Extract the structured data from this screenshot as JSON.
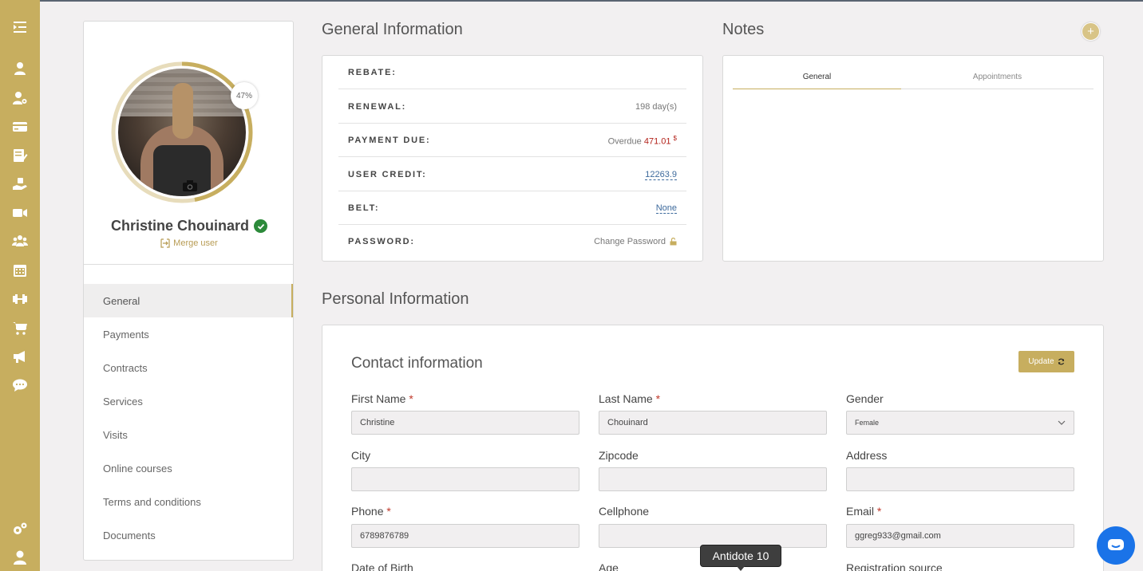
{
  "profile": {
    "name": "Christine Chouinard",
    "completion": "47%",
    "merge_label": "Merge user",
    "nav": [
      "General",
      "Payments",
      "Contracts",
      "Services",
      "Visits",
      "Online courses",
      "Terms and conditions",
      "Documents"
    ],
    "active_nav": "General",
    "completion_fraction": 0.47
  },
  "general_info": {
    "title": "General Information",
    "rows": [
      {
        "label": "REBATE:",
        "value": ""
      },
      {
        "label": "RENEWAL:",
        "value": "198 day(s)"
      },
      {
        "label": "PAYMENT DUE:",
        "prefix": "Overdue",
        "value": "471.01",
        "unit": "$"
      },
      {
        "label": "USER CREDIT:",
        "value": "12263.9"
      },
      {
        "label": "BELT:",
        "value": "None"
      },
      {
        "label": "PASSWORD:",
        "value": "Change Password"
      }
    ]
  },
  "notes": {
    "title": "Notes",
    "add_symbol": "+",
    "tabs": [
      "General",
      "Appointments"
    ],
    "active_tab": "General"
  },
  "personal_info": {
    "title": "Personal Information",
    "section_title": "Contact information",
    "update_label": "Update",
    "fields": {
      "first_name": {
        "label": "First Name",
        "required": "*",
        "value": "Christine"
      },
      "last_name": {
        "label": "Last Name",
        "required": "*",
        "value": "Chouinard"
      },
      "gender": {
        "label": "Gender",
        "value": "Female"
      },
      "city": {
        "label": "City",
        "value": ""
      },
      "zipcode": {
        "label": "Zipcode",
        "value": ""
      },
      "address": {
        "label": "Address",
        "value": ""
      },
      "phone": {
        "label": "Phone",
        "required": "*",
        "value": "6789876789"
      },
      "cellphone": {
        "label": "Cellphone",
        "value": ""
      },
      "email": {
        "label": "Email",
        "required": "*",
        "value": "ggreg933@gmail.com"
      },
      "dob": {
        "label": "Date of Birth"
      },
      "age": {
        "label": "Age"
      },
      "registration_source": {
        "label": "Registration source"
      }
    }
  },
  "tooltip": {
    "text": "Antidote 10"
  },
  "rail_icons": [
    "collapse-menu-icon",
    "user-icon",
    "user-settings-icon",
    "credit-card-icon",
    "edit-document-icon",
    "hand-gift-icon",
    "video-camera-icon",
    "users-group-icon",
    "calendar-icon",
    "dumbbell-icon",
    "shopping-cart-icon",
    "megaphone-icon",
    "chat-bubble-icon",
    "settings-gears-icon",
    "account-icon"
  ],
  "colors": {
    "accent": "#c7ae5f",
    "danger": "#b3221a",
    "link": "#3d6a9c",
    "chat": "#1a73e8"
  }
}
